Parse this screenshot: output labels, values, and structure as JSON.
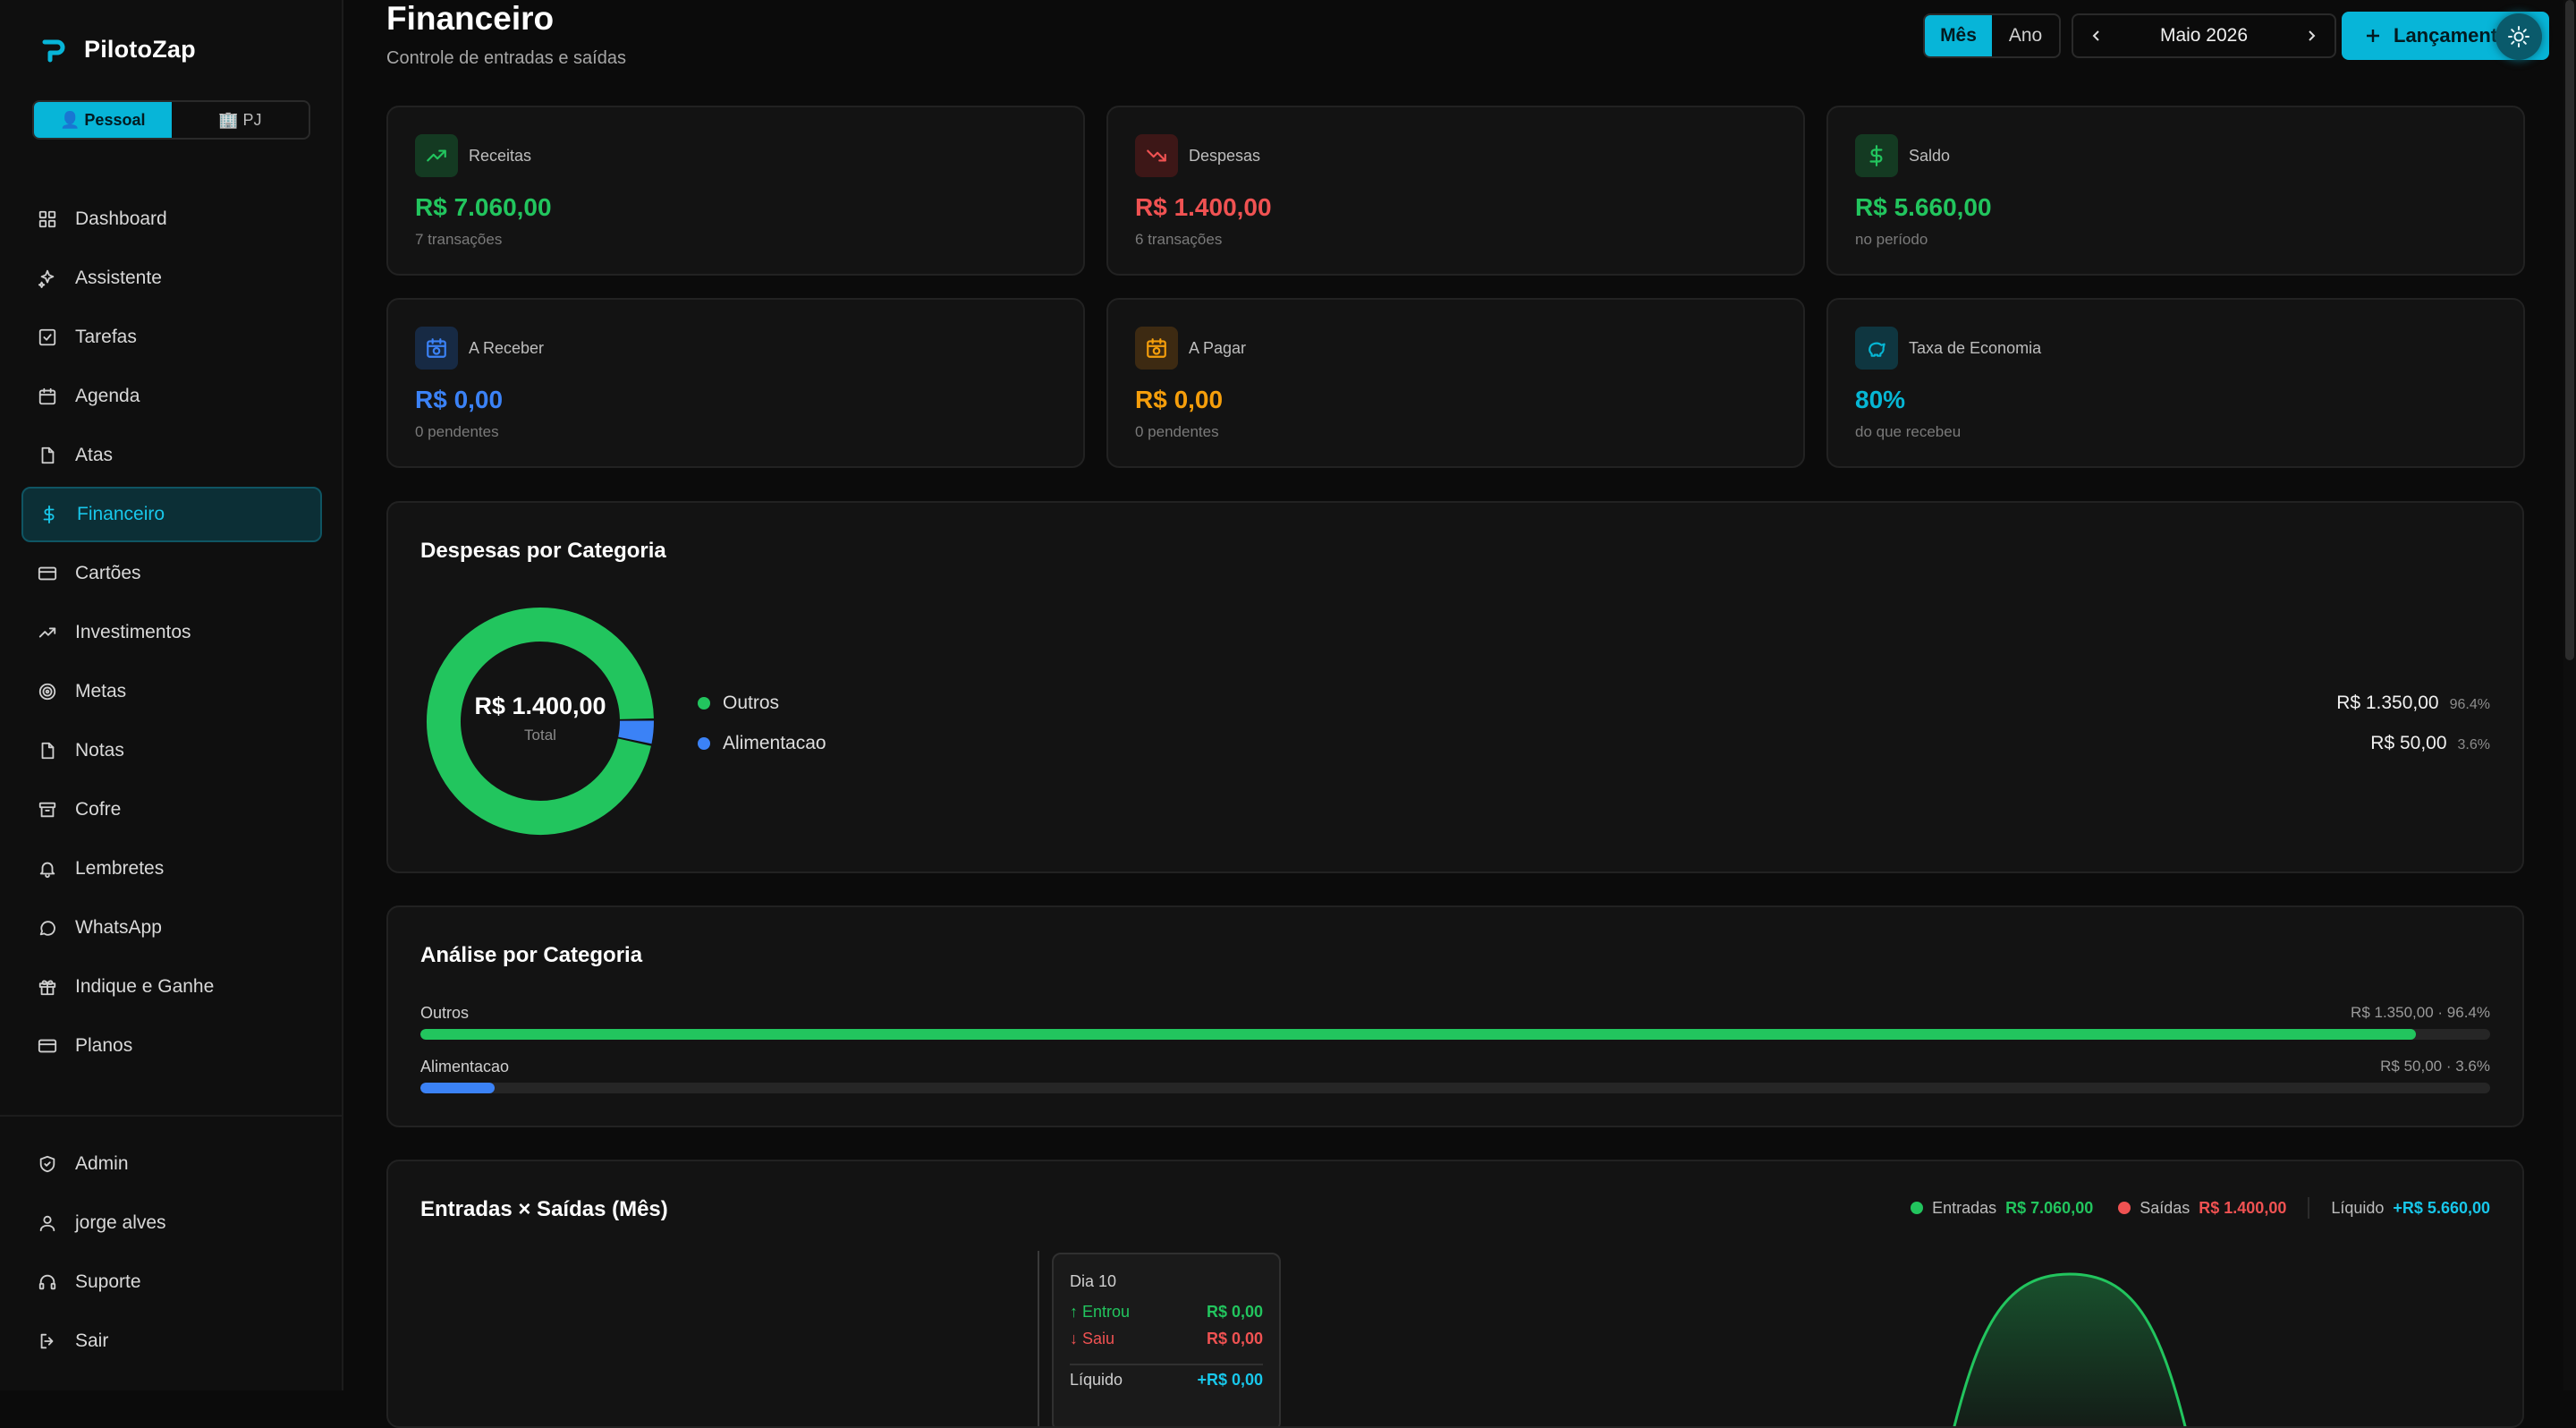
{
  "app": {
    "name": "PilotoZap"
  },
  "profile_toggle": {
    "pessoal": "👤 Pessoal",
    "pj": "🏢 PJ"
  },
  "nav": [
    {
      "label": "Dashboard",
      "icon": "grid-icon"
    },
    {
      "label": "Assistente",
      "icon": "sparkle-icon"
    },
    {
      "label": "Tarefas",
      "icon": "checkbox-icon"
    },
    {
      "label": "Agenda",
      "icon": "calendar-icon"
    },
    {
      "label": "Atas",
      "icon": "file-icon"
    },
    {
      "label": "Financeiro",
      "icon": "dollar-icon",
      "active": true
    },
    {
      "label": "Cartões",
      "icon": "card-icon"
    },
    {
      "label": "Investimentos",
      "icon": "trend-up-icon"
    },
    {
      "label": "Metas",
      "icon": "target-icon"
    },
    {
      "label": "Notas",
      "icon": "note-icon"
    },
    {
      "label": "Cofre",
      "icon": "archive-icon"
    },
    {
      "label": "Lembretes",
      "icon": "bell-icon"
    },
    {
      "label": "WhatsApp",
      "icon": "chat-icon"
    },
    {
      "label": "Indique e Ganhe",
      "icon": "gift-icon"
    },
    {
      "label": "Planos",
      "icon": "card-icon"
    }
  ],
  "nav_bottom": [
    {
      "label": "Admin",
      "icon": "shield-icon"
    },
    {
      "label": "jorge alves",
      "icon": "user-icon"
    },
    {
      "label": "Suporte",
      "icon": "headset-icon"
    },
    {
      "label": "Sair",
      "icon": "logout-icon"
    }
  ],
  "header": {
    "title": "Financeiro",
    "subtitle": "Controle de entradas e saídas",
    "period_month": "Mês",
    "period_year": "Ano",
    "current_period": "Maio 2026",
    "new_entry": "Lançamento"
  },
  "stats": [
    {
      "label": "Receitas",
      "value": "R$ 7.060,00",
      "sub": "7 transações",
      "color": "#22c55e"
    },
    {
      "label": "Despesas",
      "value": "R$ 1.400,00",
      "sub": "6 transações",
      "color": "#f05252"
    },
    {
      "label": "Saldo",
      "value": "R$ 5.660,00",
      "sub": "no período",
      "color": "#22c55e"
    },
    {
      "label": "A Receber",
      "value": "R$ 0,00",
      "sub": "0 pendentes",
      "color": "#3b82f6"
    },
    {
      "label": "A Pagar",
      "value": "R$ 0,00",
      "sub": "0 pendentes",
      "color": "#f59e0b"
    },
    {
      "label": "Taxa de Economia",
      "value": "80%",
      "sub": "do que recebeu",
      "color": "#06b6d4"
    }
  ],
  "expenses": {
    "title": "Despesas por Categoria",
    "total_value": "R$ 1.400,00",
    "total_label": "Total",
    "items": [
      {
        "name": "Outros",
        "amount": "R$ 1.350,00",
        "pct": "96.4%",
        "color": "#22c55e"
      },
      {
        "name": "Alimentacao",
        "amount": "R$ 50,00",
        "pct": "3.6%",
        "color": "#3b82f6"
      }
    ]
  },
  "chart_data": {
    "type": "pie",
    "categories": [
      "Outros",
      "Alimentacao"
    ],
    "values": [
      1350,
      50
    ],
    "title": "Despesas por Categoria"
  },
  "analysis": {
    "title": "Análise por Categoria",
    "items": [
      {
        "name": "Outros",
        "value": "R$ 1.350,00 · 96.4%",
        "fraction": 0.964,
        "color": "#22c55e"
      },
      {
        "name": "Alimentacao",
        "value": "R$ 50,00 · 3.6%",
        "fraction": 0.036,
        "color": "#3b82f6"
      }
    ]
  },
  "inout": {
    "title": "Entradas × Saídas (Mês)",
    "legend_in": "Entradas",
    "legend_in_value": "R$ 7.060,00",
    "legend_out": "Saídas",
    "legend_out_value": "R$ 1.400,00",
    "legend_net": "Líquido",
    "legend_net_value": "+R$ 5.660,00",
    "tooltip": {
      "title": "Dia 10",
      "in_label": "↑ Entrou",
      "in_value": "R$ 0,00",
      "out_label": "↓ Saiu",
      "out_value": "R$ 0,00",
      "net_label": "Líquido",
      "net_value": "+R$ 0,00"
    }
  }
}
